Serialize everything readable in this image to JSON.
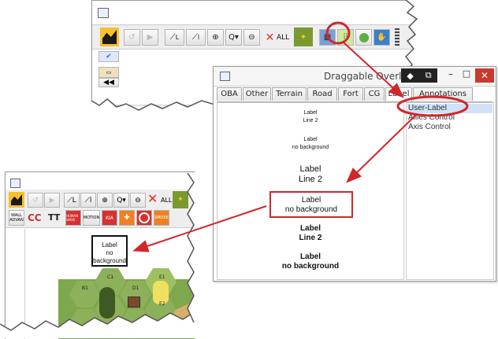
{
  "top_window": {
    "title_icon": "app-icon",
    "toolbar": [
      {
        "icon": "map-splash-icon"
      },
      {
        "icon": "undo-icon"
      },
      {
        "icon": "step-forward-icon"
      },
      {
        "icon": "los-line-icon",
        "label": "L"
      },
      {
        "icon": "los-line-icon",
        "label": "l"
      },
      {
        "icon": "zoom-in-icon"
      },
      {
        "icon": "zoom-select-icon"
      },
      {
        "icon": "zoom-out-icon"
      },
      {
        "icon": "clear-x-icon"
      },
      {
        "label": "ALL"
      },
      {
        "icon": "counter-icon"
      },
      {
        "icon": "overlay-map-icon"
      },
      {
        "icon": "draggable-overlays-icon"
      },
      {
        "icon": "circle-icon"
      },
      {
        "icon": "overlay-hand-icon"
      }
    ]
  },
  "overlay_dialog": {
    "title": "Draggable Overlays",
    "tabs": [
      "OBA",
      "Other",
      "Terrain",
      "Road",
      "Fort",
      "CG",
      "Label",
      "Annotations"
    ],
    "selected_tab": "Label",
    "labels": [
      {
        "line1": "Label",
        "line2": "Line 2",
        "style": "small"
      },
      {
        "line1": "Label",
        "line2": "no background",
        "style": "small"
      },
      {
        "line1": "Label",
        "line2": "Line 2",
        "style": "medium"
      },
      {
        "line1": "Label",
        "line2": "no background",
        "style": "medium-boxed"
      },
      {
        "line1": "Label",
        "line2": "Line 2",
        "style": "bold"
      },
      {
        "line1": "Label",
        "line2": "no background",
        "style": "bold"
      }
    ],
    "list_items": [
      "User-Label",
      "Allies Control",
      "Axis Control"
    ],
    "selected_item": "User-Label"
  },
  "map_window": {
    "toolbar_row2": [
      "WALL ADVAN",
      "CC",
      "TT",
      "HUMAN WAVE",
      "MOTION",
      "KIA",
      "",
      "",
      "SMOKE"
    ],
    "map_label": {
      "line1": "Label",
      "line2": "no background"
    },
    "hex_labels": [
      "B1",
      "C1",
      "D1",
      "E1",
      "E2"
    ],
    "colors": {
      "hex_green": "#8db05a",
      "hex_yellow": "#f0e060",
      "road": "#d4b06a"
    }
  },
  "annotation_color": "#d0272b"
}
